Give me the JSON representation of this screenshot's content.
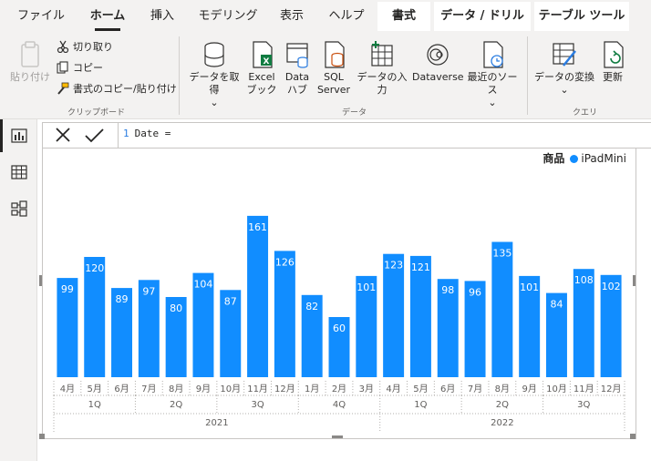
{
  "menu": {
    "tabs": [
      "ファイル",
      "ホーム",
      "挿入",
      "モデリング",
      "表示",
      "ヘルプ"
    ],
    "context_tabs": [
      "書式",
      "データ / ドリル",
      "テーブル ツール"
    ]
  },
  "ribbon": {
    "clipboard": {
      "paste": "貼り付け",
      "cut": "切り取り",
      "copy": "コピー",
      "format_painter": "書式のコピー/貼り付け",
      "group_label": "クリップボード"
    },
    "data": {
      "get_data": "データを取得",
      "excel_1": "Excel",
      "excel_2": "ブック",
      "hub_1": "Data",
      "hub_2": "ハブ",
      "sql_1": "SQL",
      "sql_2": "Server",
      "enter_data": "データの入力",
      "dataverse": "Dataverse",
      "recent": "最近のソース",
      "group_label": "データ"
    },
    "query": {
      "transform": "データの変換",
      "refresh": "更新",
      "group_label": "クエリ"
    }
  },
  "formula_bar": {
    "line_number": "1",
    "text": "Date ="
  },
  "chart_data": {
    "type": "bar",
    "legend_title": "商品",
    "series": [
      {
        "name": "iPadMini",
        "values": [
          99,
          120,
          89,
          97,
          80,
          104,
          87,
          161,
          126,
          82,
          60,
          101,
          123,
          121,
          98,
          96,
          135,
          101,
          84,
          108,
          102
        ]
      }
    ],
    "categories": [
      "4月",
      "5月",
      "6月",
      "7月",
      "8月",
      "9月",
      "10月",
      "11月",
      "12月",
      "1月",
      "2月",
      "3月",
      "4月",
      "5月",
      "6月",
      "7月",
      "8月",
      "9月",
      "10月",
      "11月",
      "12月"
    ],
    "quarters": [
      {
        "label": "1Q",
        "span": 3
      },
      {
        "label": "2Q",
        "span": 3
      },
      {
        "label": "3Q",
        "span": 3
      },
      {
        "label": "4Q",
        "span": 3
      },
      {
        "label": "1Q",
        "span": 3
      },
      {
        "label": "2Q",
        "span": 3
      },
      {
        "label": "3Q",
        "span": 3
      }
    ],
    "years": [
      {
        "label": "2021",
        "span": 12
      },
      {
        "label": "2022",
        "span": 9
      }
    ],
    "color": "#118dff",
    "ylim": [
      0,
      175
    ]
  }
}
